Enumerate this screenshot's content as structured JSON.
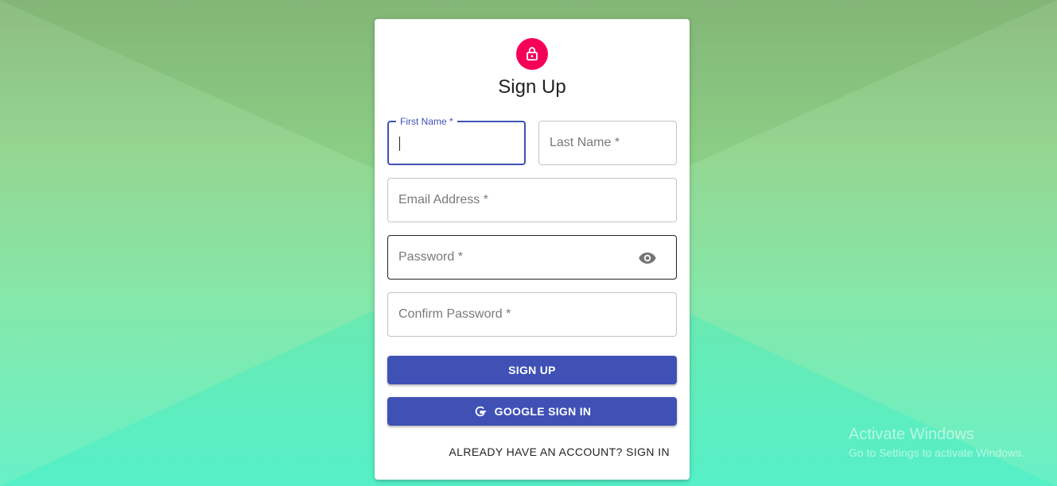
{
  "form": {
    "title": "Sign Up",
    "first_name_label": "First Name *",
    "last_name_placeholder": "Last Name *",
    "email_placeholder": "Email Address *",
    "password_placeholder": "Password *",
    "confirm_password_placeholder": "Confirm Password *",
    "sign_up_button": "SIGN UP",
    "google_button": "GOOGLE SIGN IN",
    "signin_link": "ALREADY HAVE AN ACCOUNT? SIGN IN"
  },
  "icons": {
    "avatar": "lock-icon",
    "password_toggle": "eye-icon",
    "google": "google-icon"
  },
  "colors": {
    "primary": "#3f51b5",
    "avatar": "#f50057"
  },
  "watermark": {
    "line1": "Activate Windows",
    "line2": "Go to Settings to activate Windows."
  }
}
